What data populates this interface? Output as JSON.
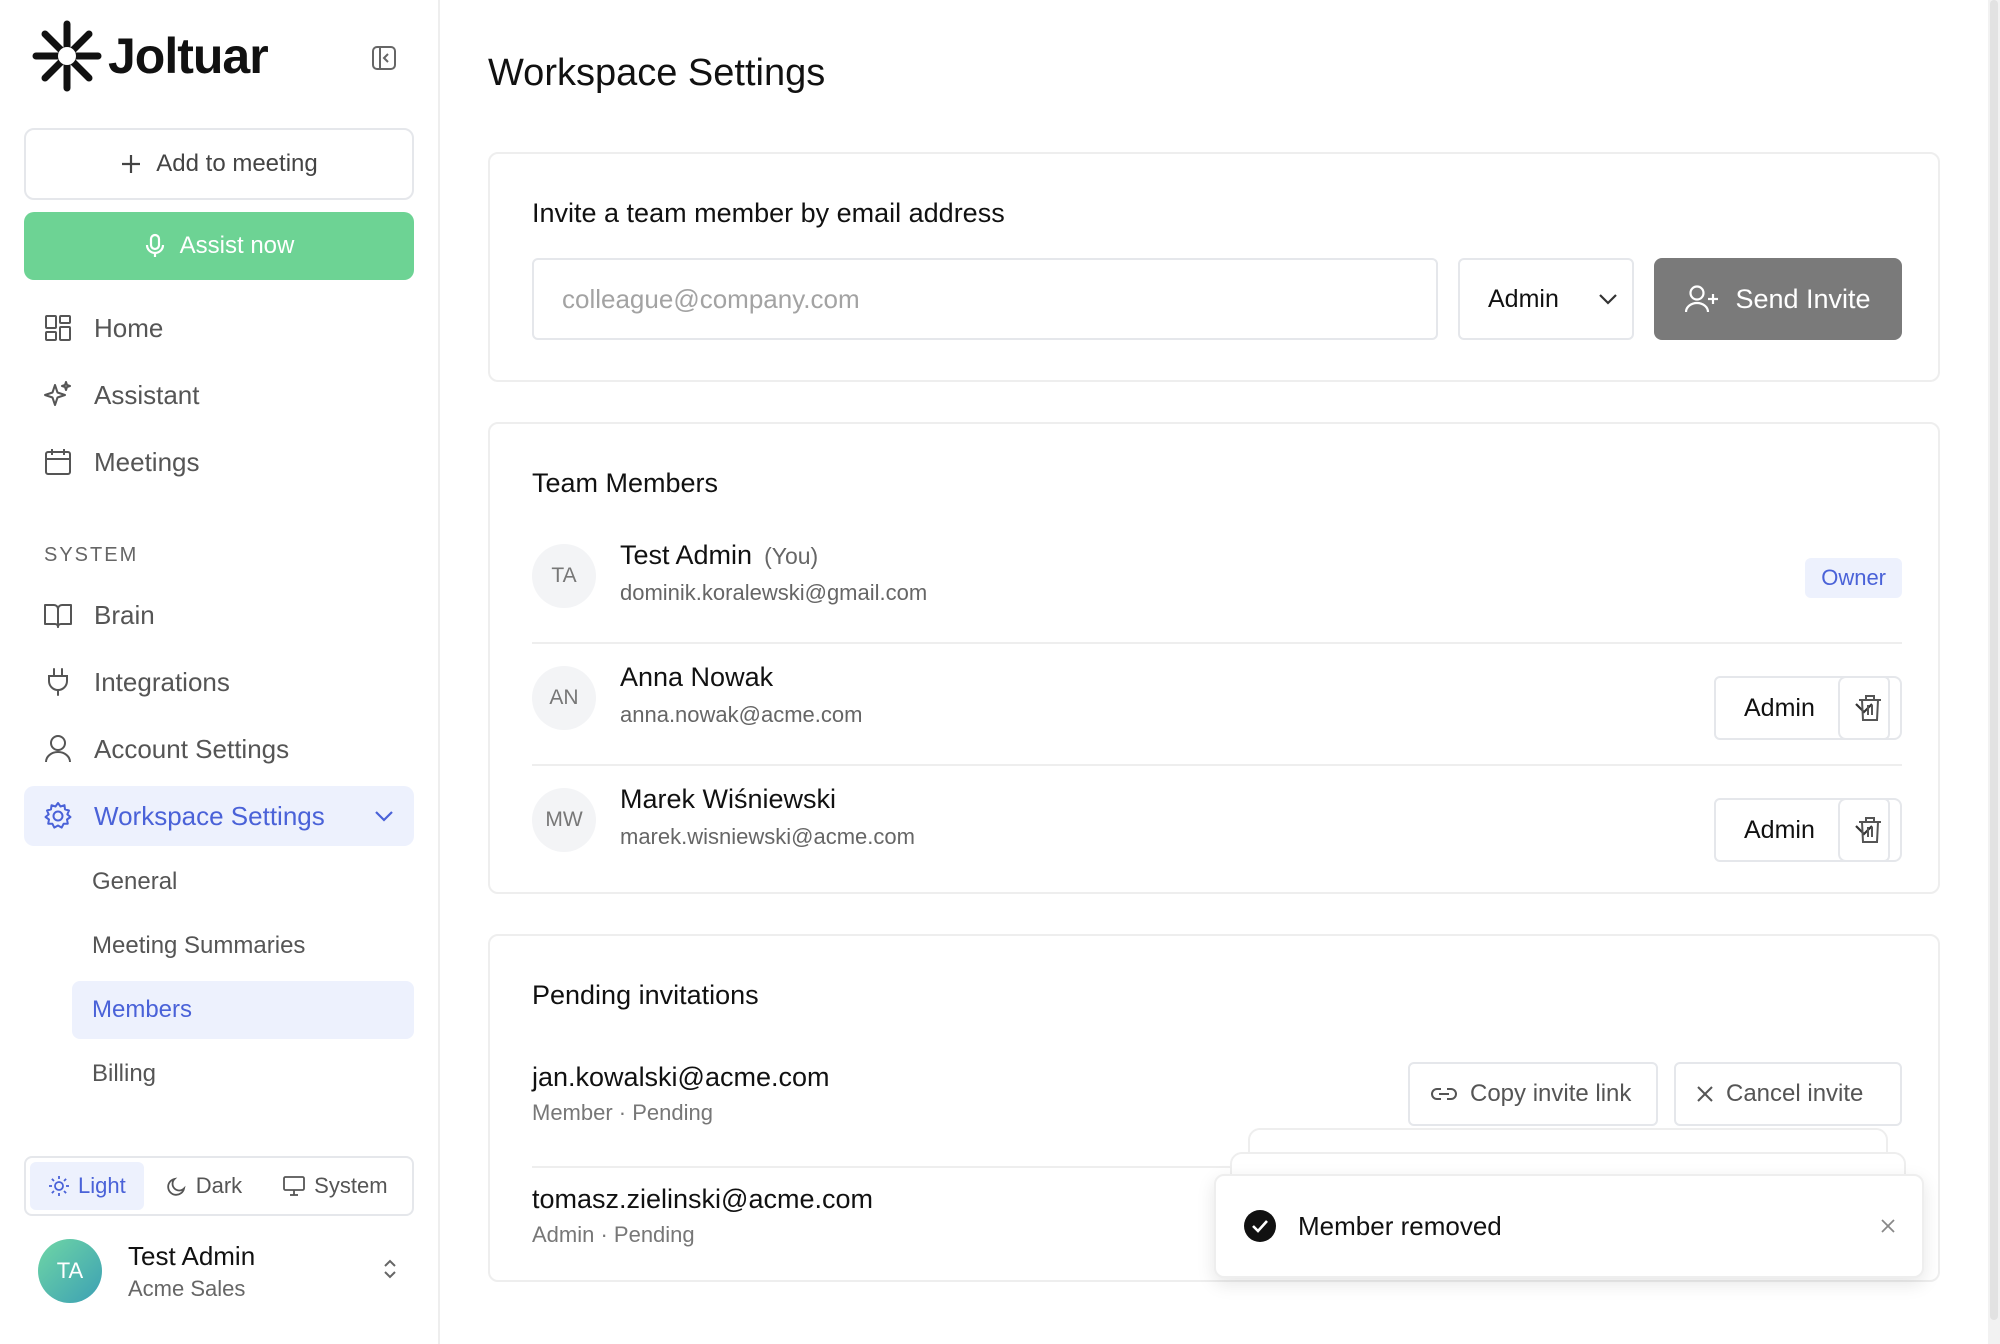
{
  "brand": {
    "name": "Joltuar"
  },
  "sidebar": {
    "add_meeting": "Add to meeting",
    "assist_now": "Assist now",
    "nav": [
      {
        "label": "Home",
        "icon": "grid-icon"
      },
      {
        "label": "Assistant",
        "icon": "sparkle-icon"
      },
      {
        "label": "Meetings",
        "icon": "calendar-icon"
      }
    ],
    "section_label": "SYSTEM",
    "system_nav": [
      {
        "label": "Brain",
        "icon": "book-icon"
      },
      {
        "label": "Integrations",
        "icon": "plug-icon"
      },
      {
        "label": "Account Settings",
        "icon": "user-icon"
      },
      {
        "label": "Workspace Settings",
        "icon": "gear-icon",
        "active": true
      }
    ],
    "sub_nav": [
      {
        "label": "General"
      },
      {
        "label": "Meeting Summaries"
      },
      {
        "label": "Members",
        "active": true
      },
      {
        "label": "Billing"
      }
    ],
    "theme": {
      "light": "Light",
      "dark": "Dark",
      "system": "System",
      "selected": "Light"
    },
    "user": {
      "initials": "TA",
      "name": "Test Admin",
      "org": "Acme Sales"
    }
  },
  "main": {
    "title": "Workspace Settings",
    "invite": {
      "heading": "Invite a team member by email address",
      "placeholder": "colleague@company.com",
      "role": "Admin",
      "send_label": "Send Invite"
    },
    "members": {
      "heading": "Team Members",
      "rows": [
        {
          "initials": "TA",
          "name": "Test Admin",
          "you": "(You)",
          "email": "dominik.koralewski@gmail.com",
          "badge": "Owner"
        },
        {
          "initials": "AN",
          "name": "Anna Nowak",
          "email": "anna.nowak@acme.com",
          "role": "Admin"
        },
        {
          "initials": "MW",
          "name": "Marek Wiśniewski",
          "email": "marek.wisniewski@acme.com",
          "role": "Admin"
        }
      ]
    },
    "pending": {
      "heading": "Pending invitations",
      "copy_label": "Copy invite link",
      "cancel_label": "Cancel invite",
      "rows": [
        {
          "email": "jan.kowalski@acme.com",
          "meta": "Member · Pending"
        },
        {
          "email": "tomasz.zielinski@acme.com",
          "meta": "Admin · Pending"
        }
      ]
    }
  },
  "toast": {
    "message": "Member removed"
  },
  "colors": {
    "accent": "#4a62d8",
    "accent_bg": "#edf1fd",
    "assist_green": "#6dd394",
    "send_gray": "#7a7a7a"
  }
}
